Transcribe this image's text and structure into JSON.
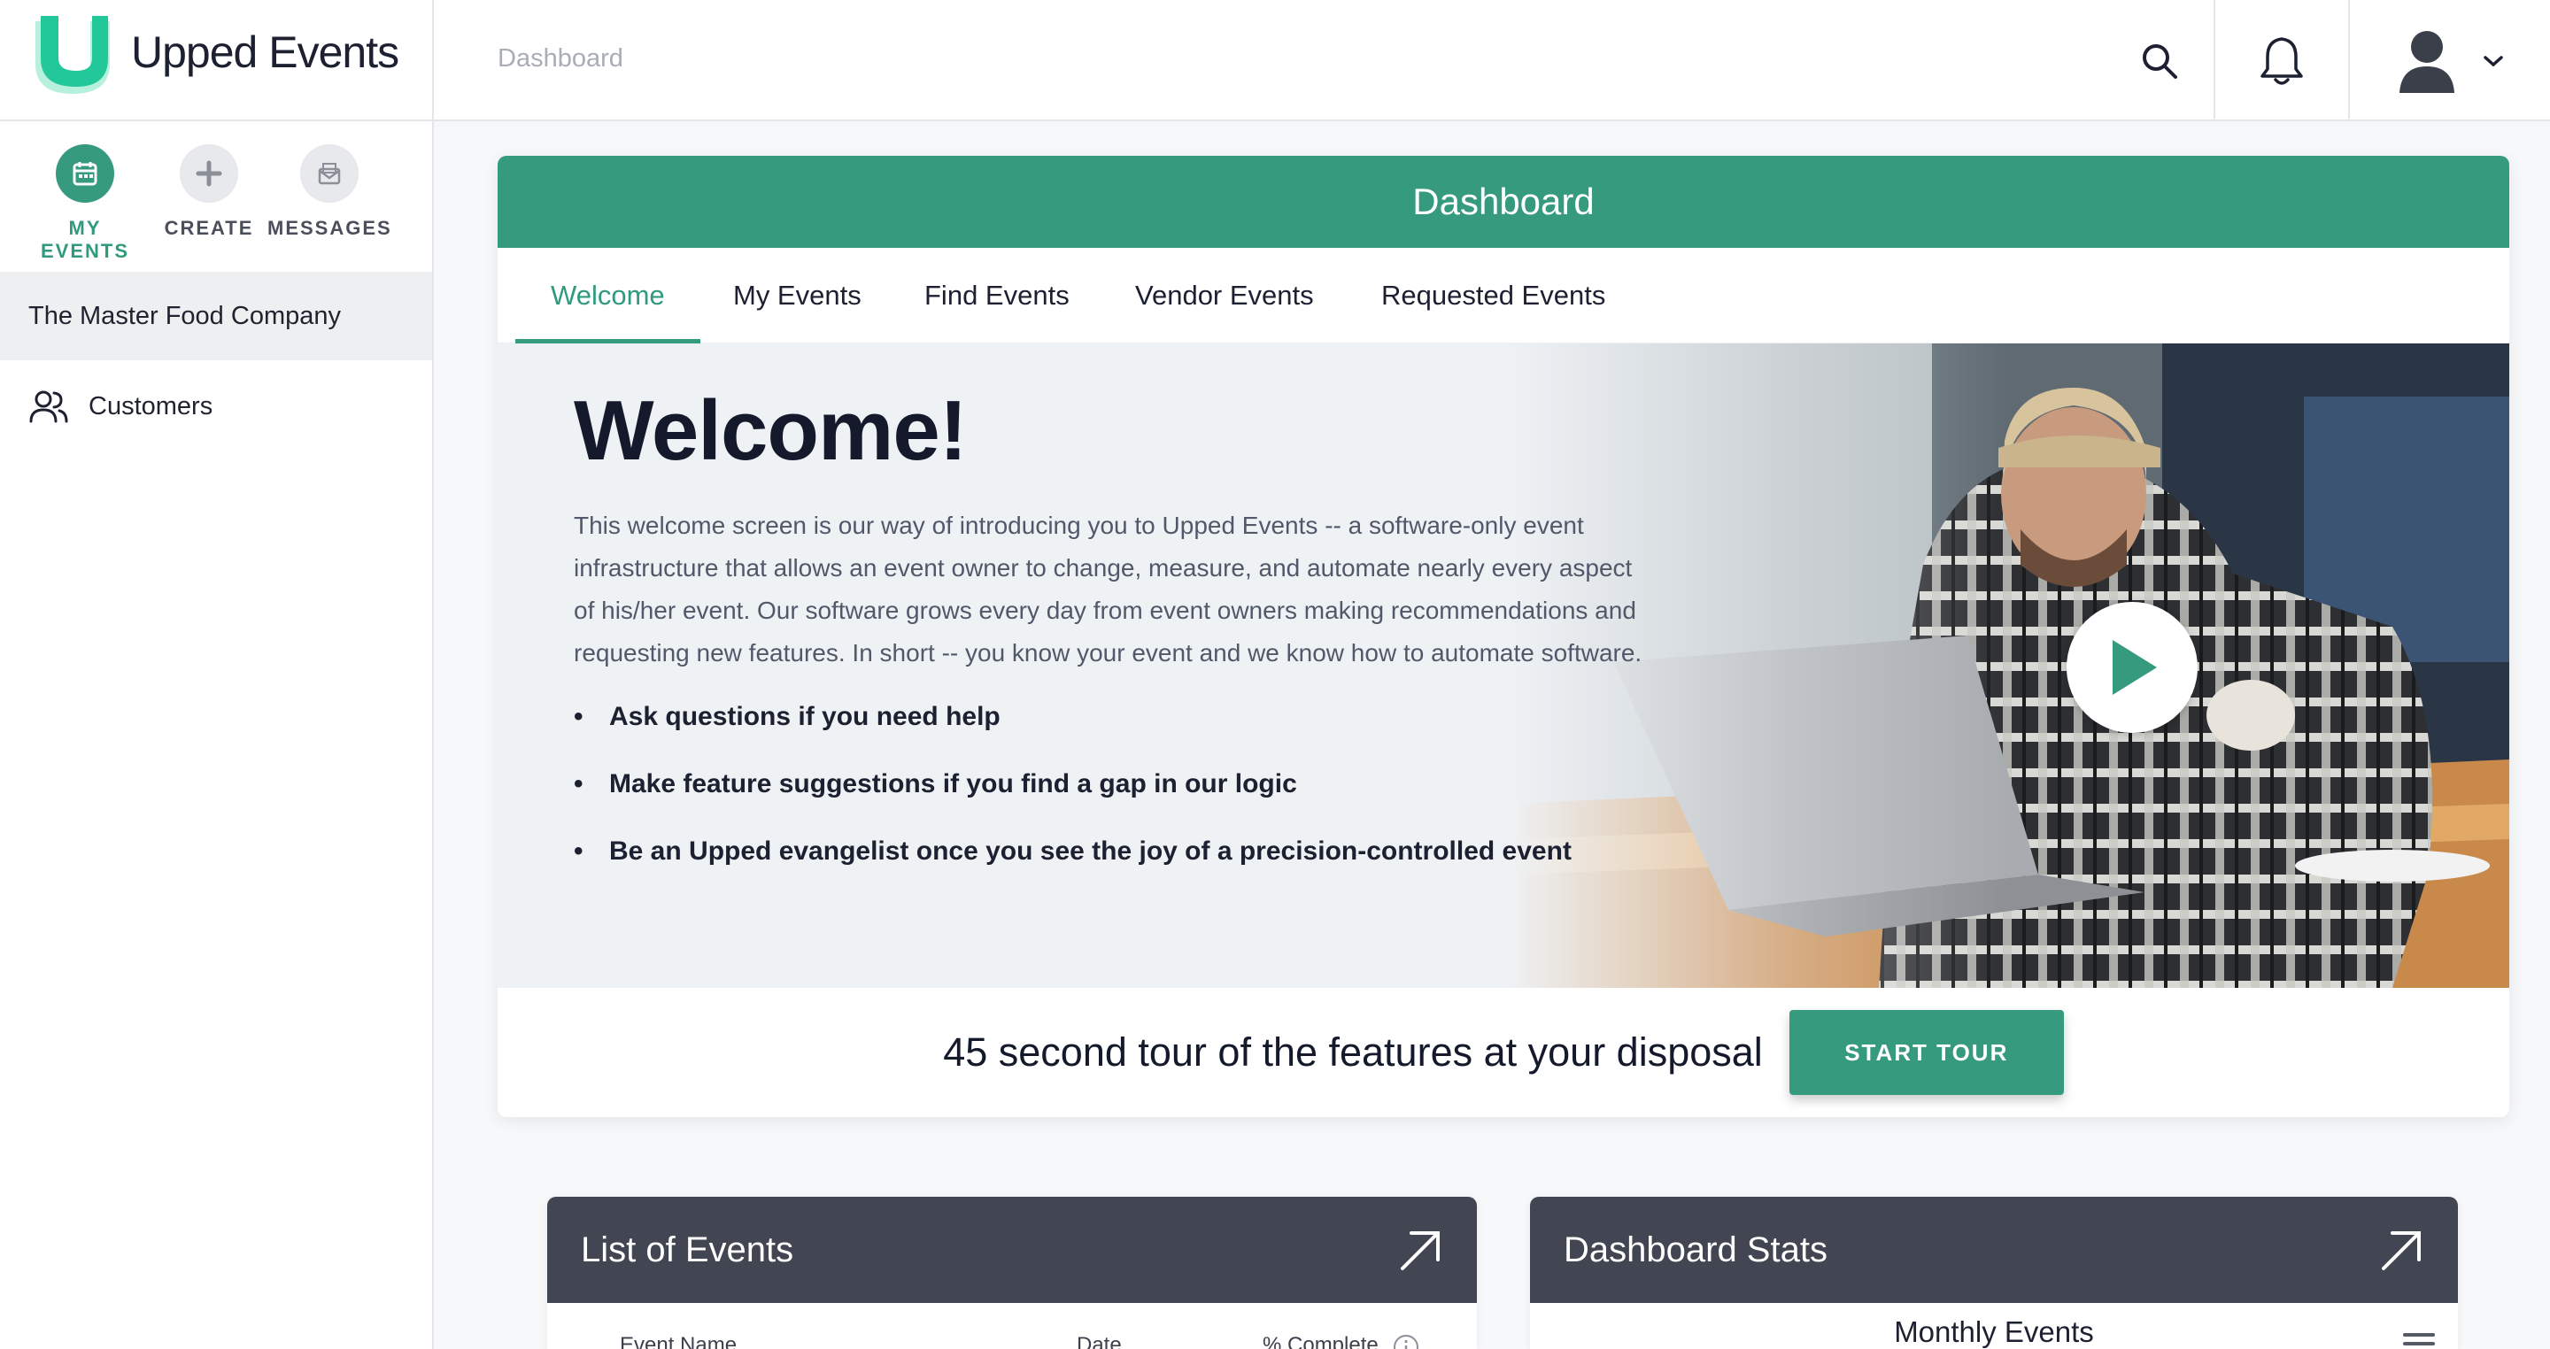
{
  "app": {
    "logo_text": "Upped Events",
    "breadcrumb": "Dashboard"
  },
  "sidebar": {
    "actions": [
      {
        "label": "MY EVENTS",
        "icon": "calendar-icon",
        "active": true
      },
      {
        "label": "CREATE",
        "icon": "plus-icon",
        "active": false
      },
      {
        "label": "MESSAGES",
        "icon": "envelope-icon",
        "active": false
      }
    ],
    "organization": "The Master Food Company",
    "items": [
      {
        "label": "Customers",
        "icon": "users-icon"
      }
    ]
  },
  "dashboard": {
    "title": "Dashboard",
    "tabs": [
      {
        "label": "Welcome",
        "active": true
      },
      {
        "label": "My Events",
        "active": false
      },
      {
        "label": "Find Events",
        "active": false
      },
      {
        "label": "Vendor Events",
        "active": false
      },
      {
        "label": "Requested Events",
        "active": false
      }
    ],
    "welcome": {
      "title": "Welcome!",
      "intro": "This welcome screen is our way of introducing you to Upped Events -- a software-only event infrastructure that allows an event owner to change, measure, and automate nearly every aspect of his/her event. Our software grows every day from event owners making recommendations and requesting new features. In short -- you know your event and we know how to automate software.",
      "bullets": [
        "Ask questions if you need help",
        "Make feature suggestions if you find a gap in our logic",
        "Be an Upped evangelist once you see the joy of a precision-controlled event"
      ]
    },
    "tour": {
      "text": "45 second tour of the features at your disposal",
      "button": "START TOUR"
    }
  },
  "widgets": {
    "events": {
      "title": "List of Events",
      "columns": [
        "Event Name",
        "Date",
        "% Complete"
      ]
    },
    "stats": {
      "title": "Dashboard Stats",
      "subtitle": "Monthly Events"
    }
  },
  "colors": {
    "accent": "#369a7e",
    "widget_header": "#414652",
    "text_dark": "#141a2b"
  }
}
